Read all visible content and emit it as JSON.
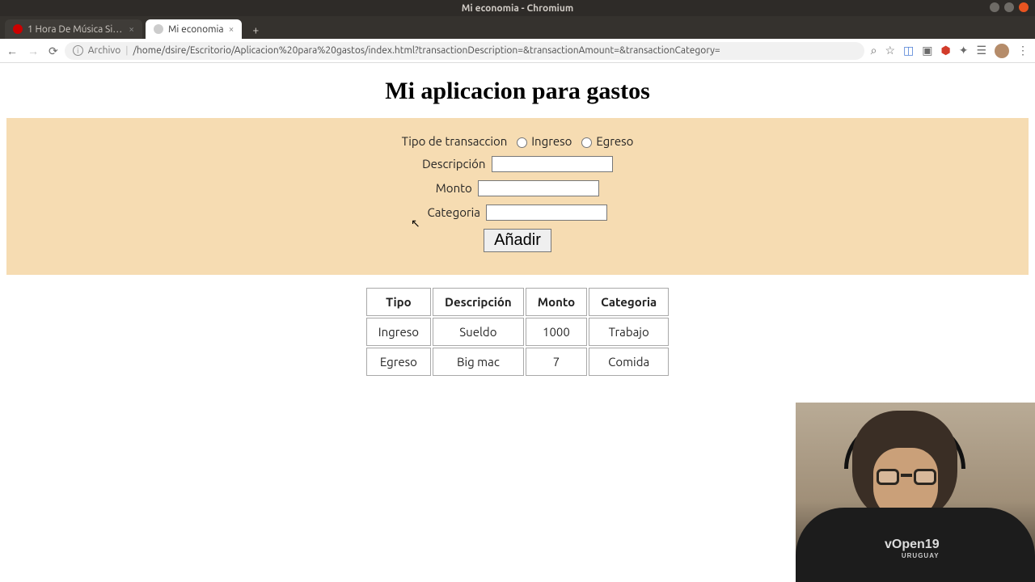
{
  "os": {
    "window_title": "Mi economia - Chromium"
  },
  "tabs": {
    "inactive": {
      "label": "1 Hora De Música Sin C"
    },
    "active": {
      "label": "Mi economia"
    }
  },
  "omnibox": {
    "scheme_label": "Archivo",
    "url": "/home/dsire/Escritorio/Aplicacion%20para%20gastos/index.html?transactionDescription=&transactionAmount=&transactionCategory="
  },
  "page": {
    "title": "Mi aplicacion para gastos",
    "form": {
      "type_label": "Tipo de transaccion",
      "type_opt_in": "Ingreso",
      "type_opt_out": "Egreso",
      "desc_label": "Descripción",
      "amount_label": "Monto",
      "category_label": "Categoria",
      "submit_label": "Añadir",
      "desc_value": "",
      "amount_value": "",
      "category_value": ""
    },
    "table": {
      "headers": [
        "Tipo",
        "Descripción",
        "Monto",
        "Categoria"
      ],
      "rows": [
        {
          "c0": "Ingreso",
          "c1": "Sueldo",
          "c2": "1000",
          "c3": "Trabajo"
        },
        {
          "c0": "Egreso",
          "c1": "Big mac",
          "c2": "7",
          "c3": "Comida"
        }
      ]
    }
  },
  "webcam": {
    "shirt_logo": "vOpen19",
    "shirt_sub": "URUGUAY"
  }
}
